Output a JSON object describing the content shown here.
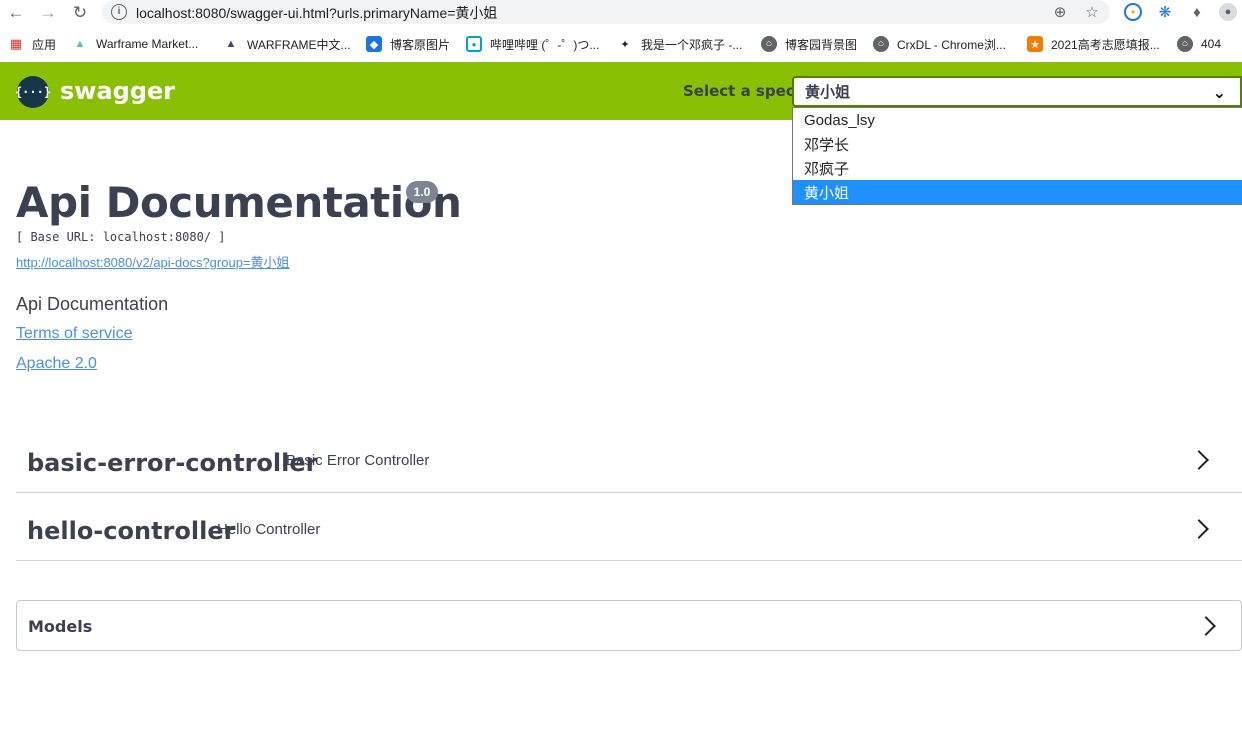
{
  "browser": {
    "url": "localhost:8080/swagger-ui.html?urls.primaryName=黄小姐",
    "bookmarks": [
      {
        "label": "应用",
        "icon": "apps-grid-icon",
        "color": "#d93025"
      },
      {
        "label": "Warframe Market...",
        "icon": "warframe-market-icon",
        "color": "#4fc3c8"
      },
      {
        "label": "WARFRAME中文...",
        "icon": "warframe-icon",
        "color": "#3a4b6b"
      },
      {
        "label": "博客原图片",
        "icon": "blog-image-icon",
        "color": "#1a73e8"
      },
      {
        "label": "哔哩哔哩 (゜-゜)つ...",
        "icon": "bilibili-icon",
        "color": "#00a1d6"
      },
      {
        "label": "我是一个邓疯子 -...",
        "icon": "ninja-icon",
        "color": "#202124"
      },
      {
        "label": "博客园背景图",
        "icon": "globe-icon",
        "color": "#5f6368"
      },
      {
        "label": "CrxDL - Chrome浏...",
        "icon": "globe-icon",
        "color": "#5f6368"
      },
      {
        "label": "2021高考志愿填报...",
        "icon": "gaokao-icon",
        "color": "#f57c00"
      },
      {
        "label": "404",
        "icon": "globe-icon",
        "color": "#5f6368"
      }
    ]
  },
  "topbar": {
    "logo_glyph": "{···}",
    "logo_text": "swagger",
    "spec_label": "Select a spec",
    "spec_selected": "黄小姐",
    "spec_options": [
      "Godas_lsy",
      "邓学长",
      "邓疯子",
      "黄小姐"
    ],
    "color": "#89bf04"
  },
  "info": {
    "title": "Api Documentation",
    "version": "1.0",
    "base_url": "[ Base URL: localhost:8080/ ]",
    "docs_url": "http://localhost:8080/v2/api-docs?group=黄小姐",
    "description": "Api Documentation",
    "terms": "Terms of service",
    "license": "Apache 2.0"
  },
  "controllers": [
    {
      "name": "basic-error-controller",
      "description": "Basic Error Controller"
    },
    {
      "name": "hello-controller",
      "description": "Hello Controller"
    }
  ],
  "models": {
    "title": "Models"
  }
}
